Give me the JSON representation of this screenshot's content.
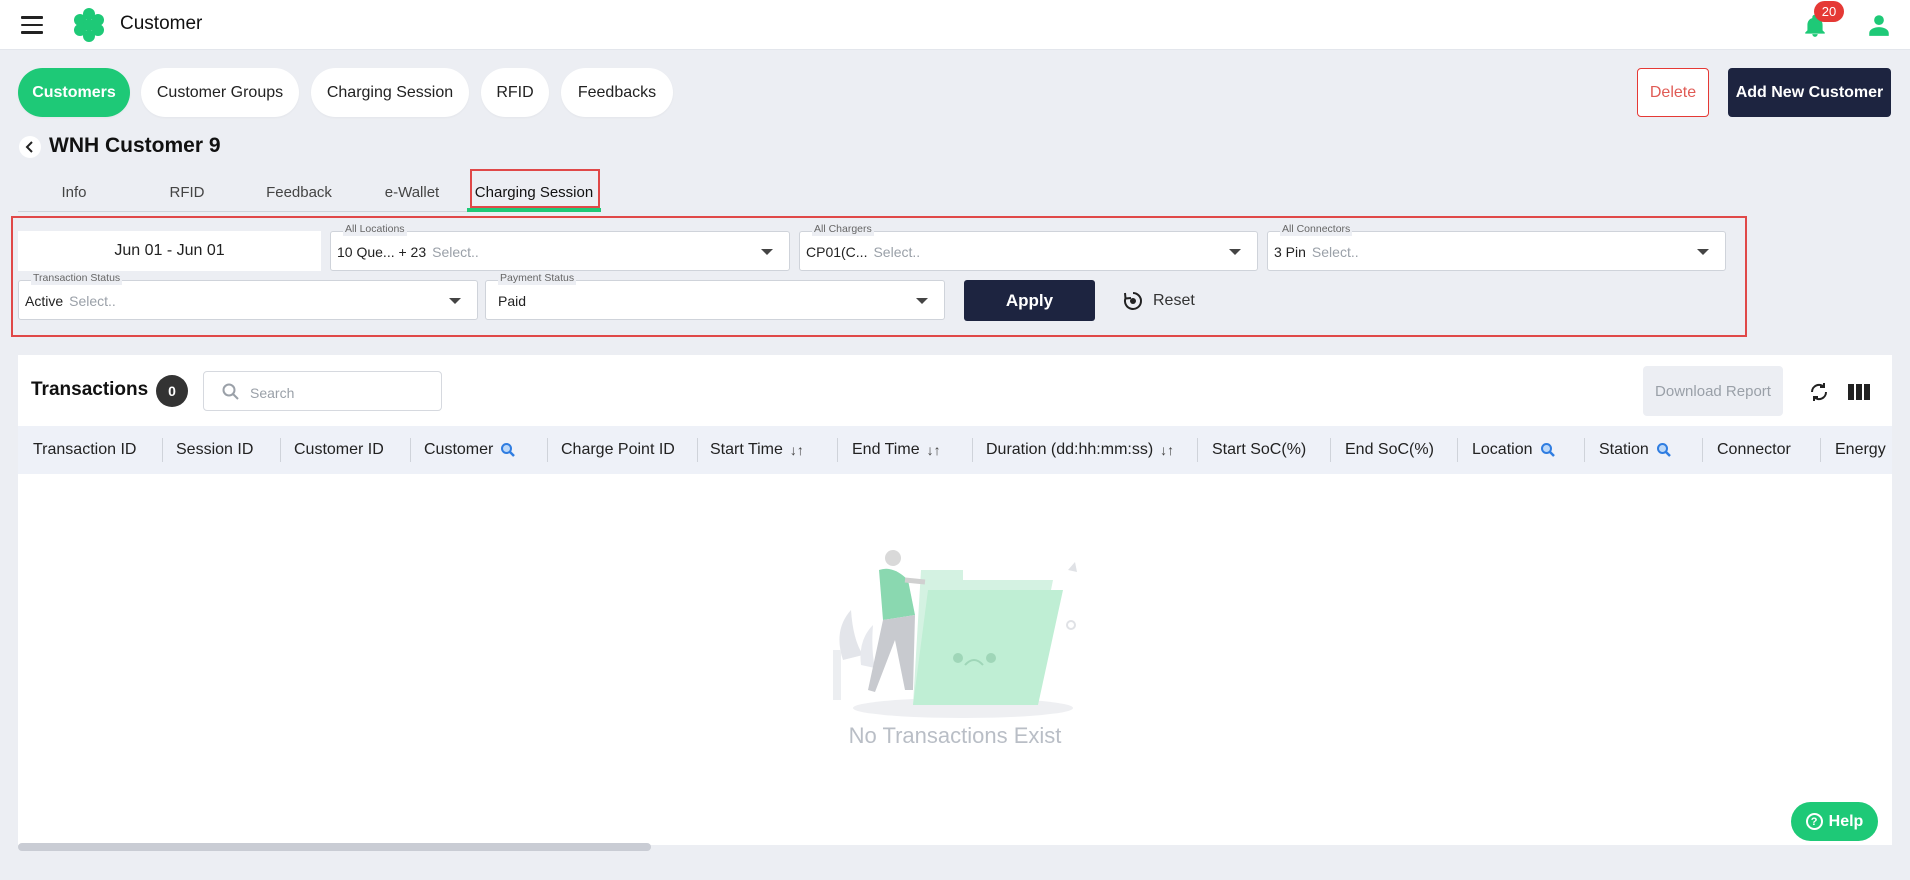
{
  "app": {
    "title": "Customer",
    "notification_count": "20",
    "accent": "#1ec977",
    "dark": "#1d2440"
  },
  "nav_tabs": [
    {
      "label": "Customers",
      "active": true
    },
    {
      "label": "Customer Groups"
    },
    {
      "label": "Charging Session"
    },
    {
      "label": "RFID"
    },
    {
      "label": "Feedbacks"
    }
  ],
  "actions": {
    "delete": "Delete",
    "add": "Add New Customer"
  },
  "page": {
    "title": "WNH Customer 9"
  },
  "sub_tabs": [
    {
      "label": "Info"
    },
    {
      "label": "RFID"
    },
    {
      "label": "Feedback"
    },
    {
      "label": "e-Wallet"
    },
    {
      "label": "Charging Session",
      "active": true
    }
  ],
  "filters": {
    "date_range": "Jun 01 - Jun 01",
    "locations": {
      "label": "All Locations",
      "value": "10 Que... + 23",
      "placeholder": "Select.."
    },
    "chargers": {
      "label": "All Chargers",
      "value": "CP01(C...",
      "placeholder": "Select.."
    },
    "connectors": {
      "label": "All Connectors",
      "value": "3 Pin",
      "placeholder": "Select.."
    },
    "transaction_status": {
      "label": "Transaction Status",
      "value": "Active",
      "placeholder": "Select.."
    },
    "payment_status": {
      "label": "Payment Status",
      "value": "Paid"
    },
    "apply": "Apply",
    "reset": "Reset"
  },
  "transactions": {
    "title": "Transactions",
    "count": "0",
    "search_placeholder": "Search",
    "download": "Download Report",
    "columns": [
      {
        "label": "Transaction ID"
      },
      {
        "label": "Session ID"
      },
      {
        "label": "Customer ID"
      },
      {
        "label": "Customer",
        "icon": "search-icon"
      },
      {
        "label": "Charge Point ID"
      },
      {
        "label": "Start Time",
        "icon": "sort-icon"
      },
      {
        "label": "End Time",
        "icon": "sort-icon"
      },
      {
        "label": "Duration (dd:hh:mm:ss)",
        "icon": "sort-icon"
      },
      {
        "label": "Start SoC(%)"
      },
      {
        "label": "End SoC(%)"
      },
      {
        "label": "Location",
        "icon": "search-icon"
      },
      {
        "label": "Station",
        "icon": "search-icon"
      },
      {
        "label": "Connector"
      },
      {
        "label": "Energy"
      }
    ],
    "empty_text": "No Transactions Exist"
  },
  "help": "Help"
}
